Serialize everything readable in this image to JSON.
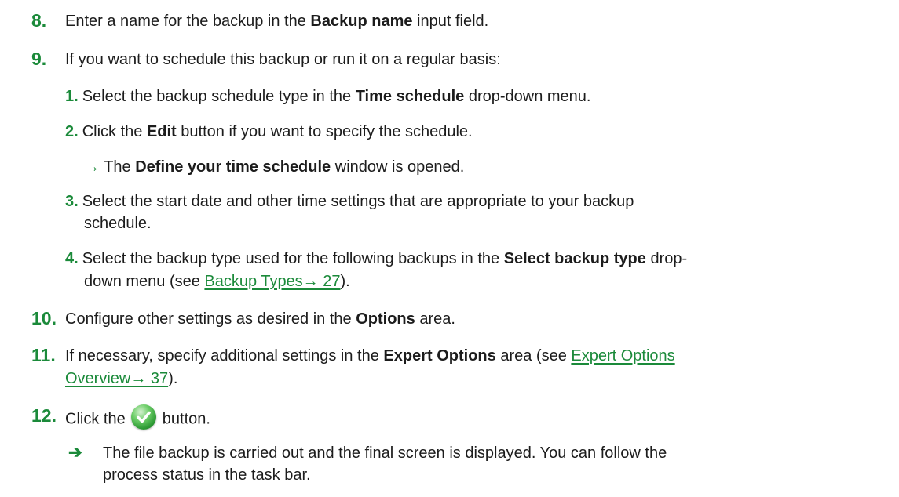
{
  "steps": {
    "s8": {
      "num": "8.",
      "t1": "Enter a name for the backup in the ",
      "b1": "Backup name",
      "t2": " input field."
    },
    "s9": {
      "num": "9.",
      "t1": "If you want to schedule this backup or run it on a regular basis:",
      "sub": {
        "a": {
          "num": "1.",
          "t1": "Select the backup schedule type in the ",
          "b1": "Time schedule",
          "t2": " drop-down menu."
        },
        "b": {
          "num": "2.",
          "t1": "Click the ",
          "b1": "Edit",
          "t2": " button if you want to specify the schedule."
        },
        "b_result": {
          "arrow": "→",
          "t1": " The ",
          "b1": "Define your time schedule",
          "t2": " window is opened."
        },
        "c": {
          "num": "3.",
          "l1": "Select the start date and other time settings that are appropriate to your backup",
          "l2": "schedule."
        },
        "d": {
          "num": "4.",
          "t1": "Select the backup type used for the following backups in the ",
          "b1": "Select backup type",
          "t2": " drop-",
          "t3": "down menu (see ",
          "link": "Backup Types→ 27",
          "t4": ")."
        }
      }
    },
    "s10": {
      "num": "10.",
      "t1": "Configure other settings as desired in the ",
      "b1": "Options",
      "t2": " area."
    },
    "s11": {
      "num": "11.",
      "t1": "If necessary, specify additional settings in the ",
      "b1": "Expert Options",
      "t2": " area (see ",
      "link1": "Expert Options",
      "link2": "Overview→ 37",
      "t3": ")."
    },
    "s12": {
      "num": "12.",
      "t1": "Click the ",
      "icon": "ok-checkmark-icon",
      "t2": " button."
    },
    "result": {
      "arrow": "➔",
      "l1": "The file backup is carried out and the final screen is displayed. You can follow the",
      "l2": "process status in the task bar."
    }
  },
  "colors": {
    "accent": "#1b8a3a",
    "text": "#1c1c1c"
  }
}
